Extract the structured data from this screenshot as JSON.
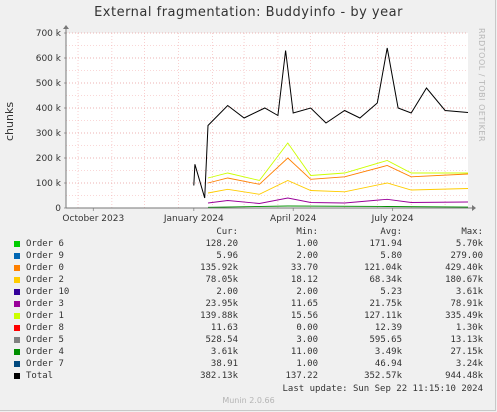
{
  "title": "External fragmentation: Buddyinfo - by year",
  "watermark": "RRDTOOL / TOBI OETIKER",
  "legend_header": {
    "cur": "Cur:",
    "min": "Min:",
    "avg": "Avg:",
    "max": "Max:"
  },
  "legend": [
    {
      "name": "Order 6",
      "color": "#00cc00",
      "cur": "128.20",
      "min": "1.00",
      "avg": "171.94",
      "max": "5.70k"
    },
    {
      "name": "Order 9",
      "color": "#0066b3",
      "cur": "5.96",
      "min": "2.00",
      "avg": "5.80",
      "max": "279.00"
    },
    {
      "name": "Order 0",
      "color": "#ff8000",
      "cur": "135.92k",
      "min": "33.70",
      "avg": "121.04k",
      "max": "429.40k"
    },
    {
      "name": "Order 2",
      "color": "#ffcc00",
      "cur": "78.05k",
      "min": "18.12",
      "avg": "68.34k",
      "max": "180.67k"
    },
    {
      "name": "Order 10",
      "color": "#330099",
      "cur": "2.00",
      "min": "2.00",
      "avg": "5.23",
      "max": "3.61k"
    },
    {
      "name": "Order 3",
      "color": "#990099",
      "cur": "23.95k",
      "min": "11.65",
      "avg": "21.75k",
      "max": "78.91k"
    },
    {
      "name": "Order 1",
      "color": "#ccff00",
      "cur": "139.88k",
      "min": "15.56",
      "avg": "127.11k",
      "max": "335.49k"
    },
    {
      "name": "Order 8",
      "color": "#ff0000",
      "cur": "11.63",
      "min": "0.00",
      "avg": "12.39",
      "max": "1.30k"
    },
    {
      "name": "Order 5",
      "color": "#808080",
      "cur": "528.54",
      "min": "3.00",
      "avg": "595.65",
      "max": "13.13k"
    },
    {
      "name": "Order 4",
      "color": "#008f00",
      "cur": "3.61k",
      "min": "11.00",
      "avg": "3.49k",
      "max": "27.15k"
    },
    {
      "name": "Order 7",
      "color": "#00487d",
      "cur": "38.91",
      "min": "1.00",
      "avg": "46.94",
      "max": "3.24k"
    },
    {
      "name": "Total",
      "color": "#000000",
      "cur": "382.13k",
      "min": "137.22",
      "avg": "352.57k",
      "max": "944.48k"
    }
  ],
  "last_update": "Last update: Sun Sep 22 11:15:10 2024",
  "footer": "Munin 2.0.66",
  "chart_data": {
    "type": "line",
    "title": "External fragmentation: Buddyinfo - by year",
    "ylabel": "chunks",
    "ylim": [
      0,
      700000
    ],
    "yticks": [
      0,
      100000,
      200000,
      300000,
      400000,
      500000,
      600000,
      700000
    ],
    "ytick_labels": [
      "0",
      "100 k",
      "200 k",
      "300 k",
      "400 k",
      "500 k",
      "600 k",
      "700 k"
    ],
    "xlim": [
      "2023-09-20",
      "2024-09-22"
    ],
    "xtick_labels": [
      {
        "date": "2023-10-15",
        "label": "October 2023"
      },
      {
        "date": "2024-01-15",
        "label": "January 2024"
      },
      {
        "date": "2024-04-15",
        "label": "April 2024"
      },
      {
        "date": "2024-07-15",
        "label": "July 2024"
      }
    ],
    "grid": true,
    "series": [
      {
        "name": "Total",
        "color": "#000000",
        "points": [
          [
            "2024-01-15",
            90000
          ],
          [
            "2024-01-16",
            175000
          ],
          [
            "2024-01-25",
            40000
          ],
          [
            "2024-01-28",
            330000
          ],
          [
            "2024-02-15",
            410000
          ],
          [
            "2024-03-01",
            360000
          ],
          [
            "2024-03-20",
            400000
          ],
          [
            "2024-04-01",
            370000
          ],
          [
            "2024-04-08",
            630000
          ],
          [
            "2024-04-15",
            380000
          ],
          [
            "2024-05-01",
            400000
          ],
          [
            "2024-05-15",
            340000
          ],
          [
            "2024-06-01",
            390000
          ],
          [
            "2024-06-15",
            360000
          ],
          [
            "2024-07-01",
            420000
          ],
          [
            "2024-07-10",
            640000
          ],
          [
            "2024-07-20",
            400000
          ],
          [
            "2024-08-01",
            380000
          ],
          [
            "2024-08-15",
            480000
          ],
          [
            "2024-09-01",
            390000
          ],
          [
            "2024-09-22",
            382130
          ]
        ]
      },
      {
        "name": "Order 1",
        "color": "#ccff00",
        "points": [
          [
            "2024-01-28",
            120000
          ],
          [
            "2024-02-15",
            140000
          ],
          [
            "2024-03-15",
            110000
          ],
          [
            "2024-04-10",
            260000
          ],
          [
            "2024-05-01",
            130000
          ],
          [
            "2024-06-01",
            140000
          ],
          [
            "2024-07-10",
            190000
          ],
          [
            "2024-08-01",
            140000
          ],
          [
            "2024-09-22",
            139880
          ]
        ]
      },
      {
        "name": "Order 0",
        "color": "#ff8000",
        "points": [
          [
            "2024-01-28",
            100000
          ],
          [
            "2024-02-15",
            120000
          ],
          [
            "2024-03-15",
            95000
          ],
          [
            "2024-04-10",
            200000
          ],
          [
            "2024-05-01",
            115000
          ],
          [
            "2024-06-01",
            125000
          ],
          [
            "2024-07-10",
            170000
          ],
          [
            "2024-08-01",
            125000
          ],
          [
            "2024-09-22",
            135920
          ]
        ]
      },
      {
        "name": "Order 2",
        "color": "#ffcc00",
        "points": [
          [
            "2024-01-28",
            60000
          ],
          [
            "2024-02-15",
            75000
          ],
          [
            "2024-03-15",
            55000
          ],
          [
            "2024-04-10",
            110000
          ],
          [
            "2024-05-01",
            70000
          ],
          [
            "2024-06-01",
            65000
          ],
          [
            "2024-07-10",
            100000
          ],
          [
            "2024-08-01",
            72000
          ],
          [
            "2024-09-22",
            78050
          ]
        ]
      },
      {
        "name": "Order 3",
        "color": "#990099",
        "points": [
          [
            "2024-01-28",
            20000
          ],
          [
            "2024-02-15",
            30000
          ],
          [
            "2024-03-15",
            18000
          ],
          [
            "2024-04-10",
            40000
          ],
          [
            "2024-05-01",
            22000
          ],
          [
            "2024-06-01",
            20000
          ],
          [
            "2024-07-10",
            35000
          ],
          [
            "2024-08-01",
            22000
          ],
          [
            "2024-09-22",
            23950
          ]
        ]
      },
      {
        "name": "Order 4",
        "color": "#008f00",
        "points": [
          [
            "2024-01-28",
            3000
          ],
          [
            "2024-04-10",
            8000
          ],
          [
            "2024-07-10",
            6000
          ],
          [
            "2024-09-22",
            3610
          ]
        ]
      }
    ]
  }
}
